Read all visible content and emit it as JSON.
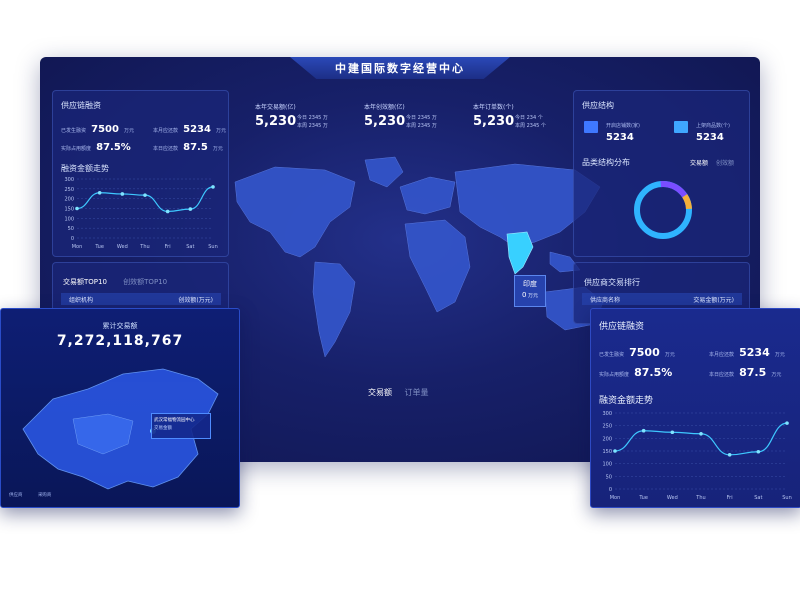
{
  "header": {
    "title": "中建国际数字经营中心"
  },
  "left_panel": {
    "title": "供应链融资",
    "metrics": [
      {
        "label": "已发生融资",
        "value": "7500",
        "unit": "万元"
      },
      {
        "label": "本月应还款",
        "value": "5234",
        "unit": "万元"
      },
      {
        "label": "实际占用额度",
        "value": "87.5%",
        "unit": ""
      },
      {
        "label": "本日应还款",
        "value": "87.5",
        "unit": "万元"
      }
    ],
    "trend_title": "融资金额走势"
  },
  "top_stats": [
    {
      "label": "本年交易额(亿)",
      "value": "5,230",
      "sub1": "今日 2345 万",
      "sub2": "本周 2345 万"
    },
    {
      "label": "本年创效额(亿)",
      "value": "5,230",
      "sub1": "今日 2345 万",
      "sub2": "本周 2345 万"
    },
    {
      "label": "本年订单数(个)",
      "value": "5,230",
      "sub1": "今日 234 个",
      "sub2": "本周 2345 个"
    }
  ],
  "right_panel": {
    "title": "供应结构",
    "items": [
      {
        "label": "开启店铺数(家)",
        "value": "5234"
      },
      {
        "label": "上架商品数(个)",
        "value": "5234"
      }
    ],
    "category_title": "品类结构分布",
    "tabs": [
      "交易额",
      "创效额"
    ]
  },
  "top10": {
    "tabs": [
      "交易额TOP10",
      "创效额TOP10"
    ],
    "columns": [
      "组织机构",
      "创效额(万元)"
    ]
  },
  "supplier_rank": {
    "title": "供应商交易排行",
    "columns": [
      "供应商名称",
      "交易金额(万元)"
    ]
  },
  "map": {
    "highlight_name": "印度",
    "highlight_value": "0",
    "highlight_unit": "万元",
    "toggles": [
      "交易额",
      "订单量"
    ]
  },
  "china_panel": {
    "title": "累计交易额",
    "value": "7,272,118,767",
    "tooltip_title": "武汉常福物流园中心",
    "tooltip_value": "交易金额",
    "legend": [
      "供应商",
      "采购商"
    ]
  },
  "right_card": {
    "title": "供应链融资",
    "metrics": [
      {
        "label": "已发生融资",
        "value": "7500",
        "unit": "万元"
      },
      {
        "label": "本月应还款",
        "value": "5234",
        "unit": "万元"
      },
      {
        "label": "实际占用额度",
        "value": "87.5%",
        "unit": ""
      },
      {
        "label": "本日应还款",
        "value": "87.5",
        "unit": "万元"
      }
    ],
    "trend_title": "融资金额走势"
  },
  "chart_data": [
    {
      "type": "line",
      "categories": [
        "Mon",
        "Tue",
        "Wed",
        "Thu",
        "Fri",
        "Sat",
        "Sun"
      ],
      "values": [
        150,
        230,
        224,
        218,
        135,
        147,
        260
      ],
      "ylim": [
        0,
        300
      ],
      "yticks": [
        0,
        50,
        100,
        150,
        200,
        250,
        300
      ],
      "title": "融资金额走势"
    },
    {
      "type": "line",
      "categories": [
        "Mon",
        "Tue",
        "Wed",
        "Thu",
        "Fri",
        "Sat",
        "Sun"
      ],
      "values": [
        150,
        230,
        224,
        218,
        135,
        147,
        260
      ],
      "ylim": [
        0,
        300
      ],
      "yticks": [
        0,
        50,
        100,
        150,
        200,
        250,
        300
      ],
      "title": "融资金额走势"
    }
  ],
  "colors": {
    "accent": "#3ec8ff",
    "bg": "#161f66",
    "donut": [
      "#2fb4ff",
      "#f5b03a",
      "#7a4dff",
      "#32d0ff"
    ]
  }
}
